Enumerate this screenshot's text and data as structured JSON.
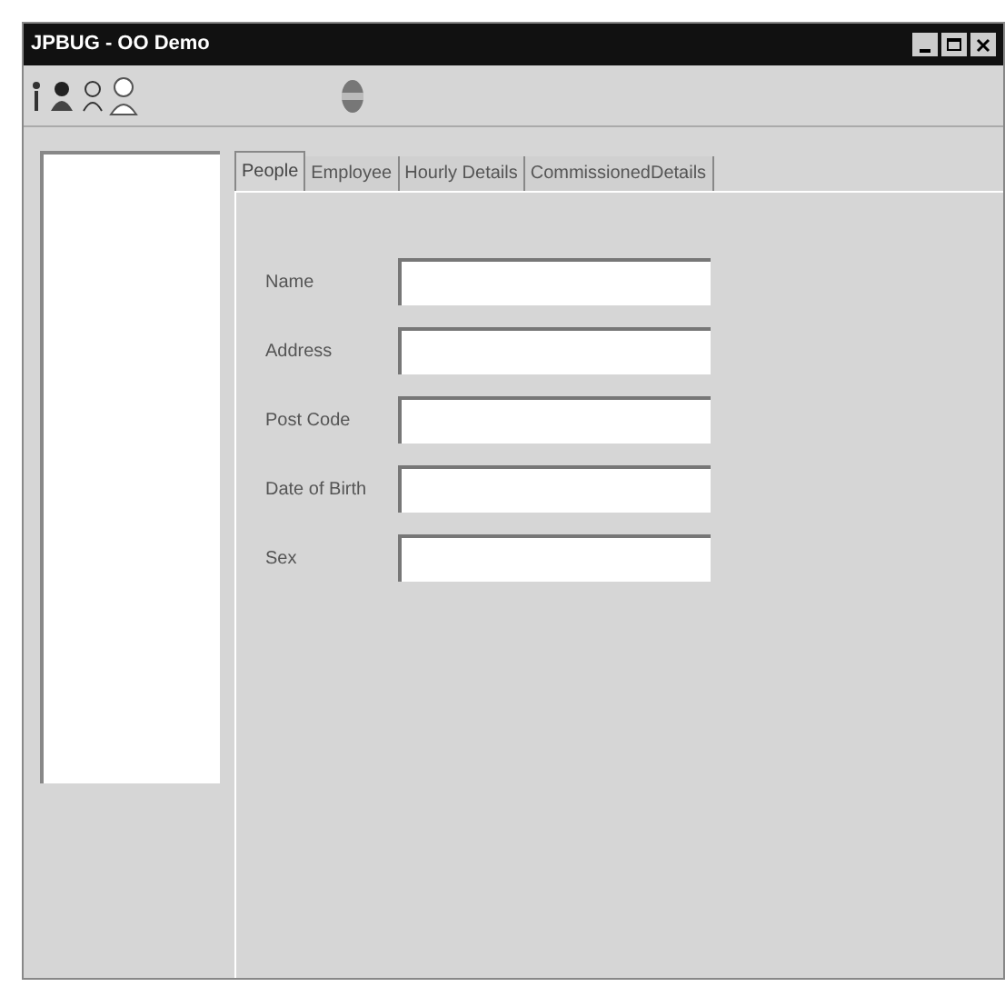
{
  "window": {
    "title": "JPBUG - OO Demo"
  },
  "tabs": [
    {
      "label": "People",
      "selected": true
    },
    {
      "label": "Employee",
      "selected": false
    },
    {
      "label": "Hourly Details",
      "selected": false
    },
    {
      "label": "CommissionedDetails",
      "selected": false
    }
  ],
  "fields": [
    {
      "label": "Name"
    },
    {
      "label": "Address"
    },
    {
      "label": "Post Code"
    },
    {
      "label": "Date of Birth"
    },
    {
      "label": "Sex"
    }
  ]
}
